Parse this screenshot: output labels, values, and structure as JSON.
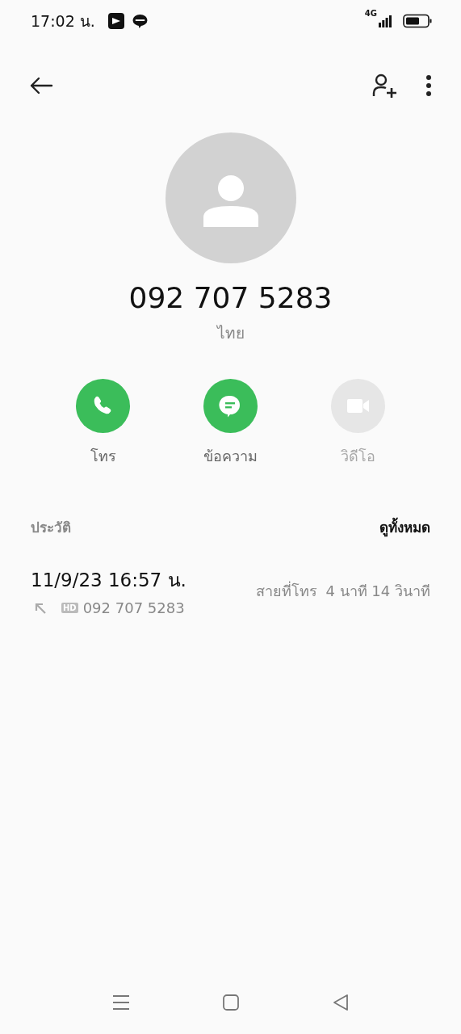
{
  "status_bar": {
    "time": "17:02 น.",
    "network": "4G"
  },
  "contact": {
    "number": "092 707 5283",
    "location": "ไทย"
  },
  "actions": [
    {
      "kind": "call",
      "label": "โทร",
      "disabled": false
    },
    {
      "kind": "message",
      "label": "ข้อความ",
      "disabled": false
    },
    {
      "kind": "video",
      "label": "วิดีโอ",
      "disabled": true
    }
  ],
  "history": {
    "title": "ประวัติ",
    "view_all": "ดูทั้งหมด",
    "entries": [
      {
        "datetime": "11/9/23 16:57 น.",
        "badge": "HD",
        "number": "092 707 5283",
        "type": "สายที่โทร",
        "duration": "4 นาที 14 วินาที"
      }
    ]
  }
}
